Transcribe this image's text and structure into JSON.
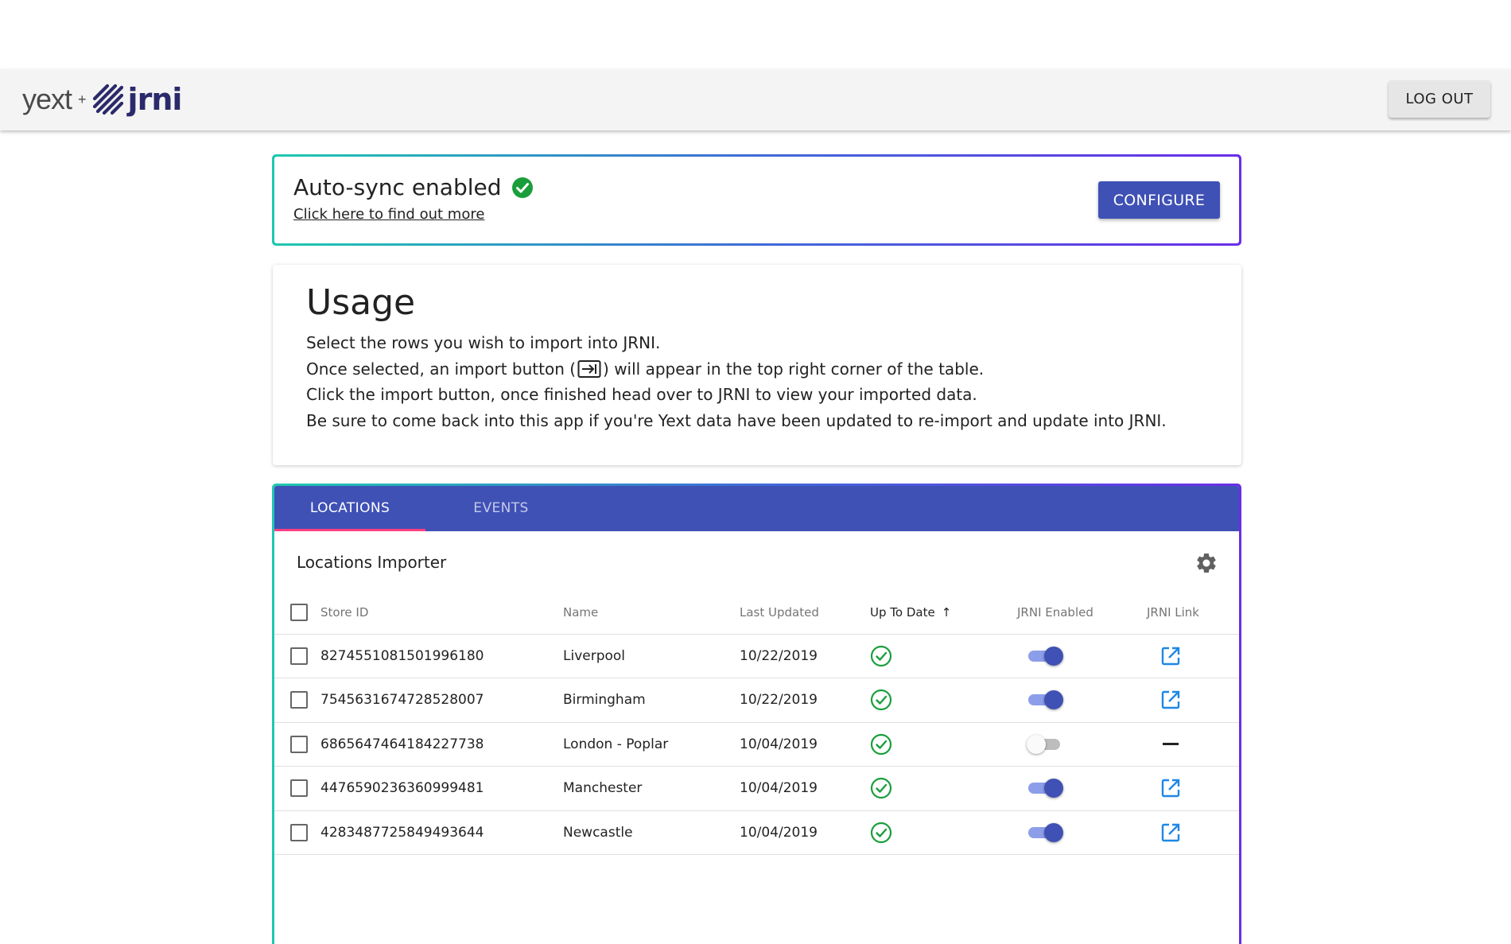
{
  "header": {
    "logo_yext": "yext",
    "logo_plus": "+",
    "logo_jrni": "jrni",
    "logout_label": "LOG OUT"
  },
  "sync": {
    "title": "Auto-sync enabled",
    "link": "Click here to find out more",
    "configure_label": "CONFIGURE",
    "status_color": "#1a9e3b"
  },
  "usage": {
    "title": "Usage",
    "line1": "Select the rows you wish to import into JRNI.",
    "line2_before": "Once selected, an import button (",
    "line2_after": ") will appear in the top right corner of the table.",
    "line3": "Click the import button, once finished head over to JRNI to view your imported data.",
    "line4": "Be sure to come back into this app if you're Yext data have been updated to re-import and update into JRNI."
  },
  "tabs": {
    "locations": "LOCATIONS",
    "events": "EVENTS",
    "active": "LOCATIONS",
    "accent": "#3f51b5",
    "indicator": "#ff4081"
  },
  "importer": {
    "title": "Locations Importer",
    "columns": {
      "store_id": "Store ID",
      "name": "Name",
      "last_updated": "Last Updated",
      "up_to_date": "Up To Date",
      "jrni_enabled": "JRNI Enabled",
      "jrni_link": "JRNI Link"
    },
    "sort_indicator": "↑",
    "rows": [
      {
        "store_id": "8274551081501996180",
        "name": "Liverpool",
        "last_updated": "10/22/2019",
        "up_to_date": true,
        "jrni_enabled": true,
        "has_link": true,
        "link_placeholder": ""
      },
      {
        "store_id": "7545631674728528007",
        "name": "Birmingham",
        "last_updated": "10/22/2019",
        "up_to_date": true,
        "jrni_enabled": true,
        "has_link": true,
        "link_placeholder": ""
      },
      {
        "store_id": "6865647464184227738",
        "name": "London - Poplar",
        "last_updated": "10/04/2019",
        "up_to_date": true,
        "jrni_enabled": false,
        "has_link": false,
        "link_placeholder": "—"
      },
      {
        "store_id": "4476590236360999481",
        "name": "Manchester",
        "last_updated": "10/04/2019",
        "up_to_date": true,
        "jrni_enabled": true,
        "has_link": true,
        "link_placeholder": ""
      },
      {
        "store_id": "4283487725849493644",
        "name": "Newcastle",
        "last_updated": "10/04/2019",
        "up_to_date": true,
        "jrni_enabled": true,
        "has_link": true,
        "link_placeholder": ""
      }
    ]
  }
}
